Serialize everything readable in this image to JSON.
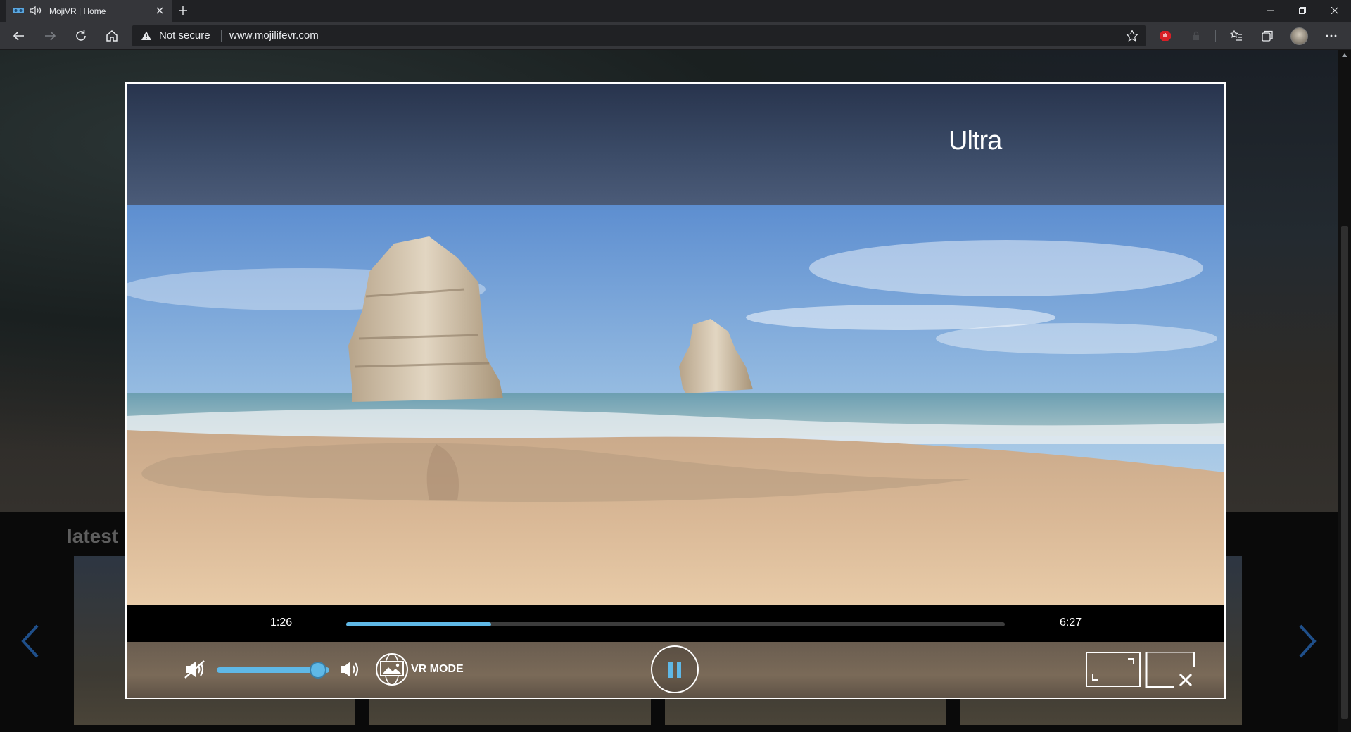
{
  "browser": {
    "tab_title": "MojiVR | Home",
    "omnibox_security": "Not secure",
    "omnibox_url": "www.mojilifevr.com"
  },
  "page": {
    "section_heading": "latest"
  },
  "player": {
    "quality_label": "Ultra",
    "current_time": "1:26",
    "total_time": "6:27",
    "progress_fraction": 0.22,
    "volume_fraction": 0.9,
    "vr_mode_label": "VR MODE",
    "accent_color": "#5fb8e6"
  }
}
